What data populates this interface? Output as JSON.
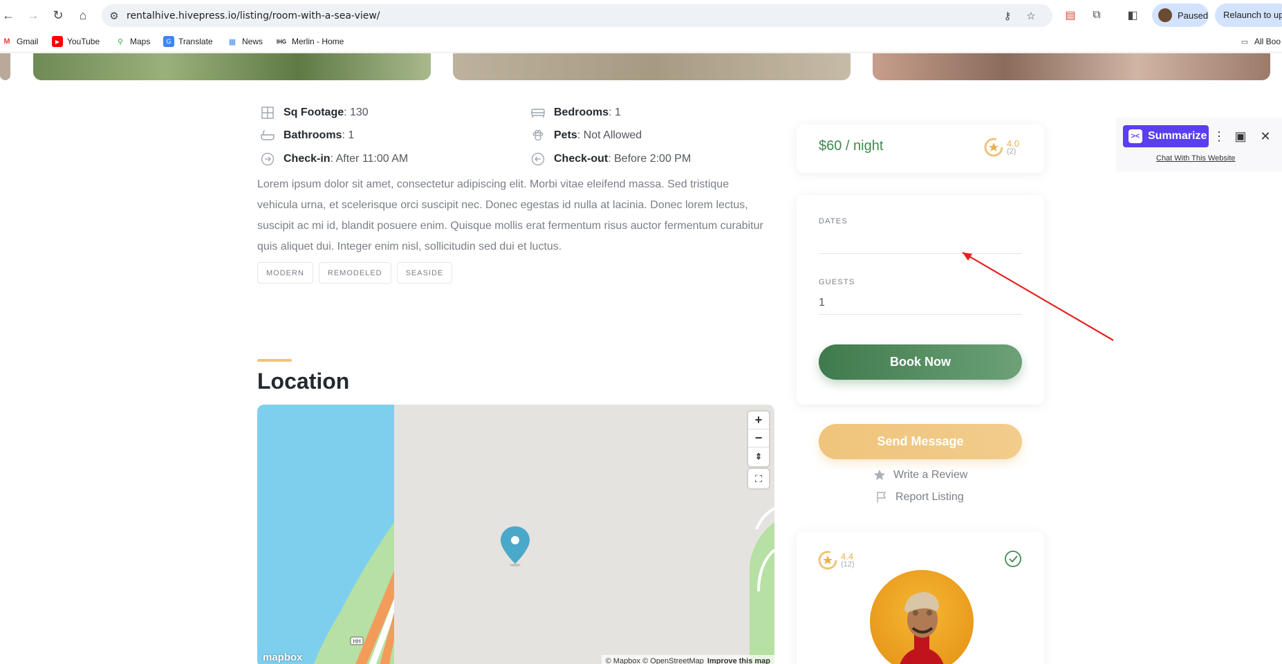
{
  "browser": {
    "url": "rentalhive.hivepress.io/listing/room-with-a-sea-view/",
    "paused_label": "Paused",
    "relaunch_label": "Relaunch to upd"
  },
  "bookmarks": [
    {
      "label": "Gmail",
      "icon": "gmail-icon"
    },
    {
      "label": "YouTube",
      "icon": "youtube-icon"
    },
    {
      "label": "Maps",
      "icon": "maps-icon"
    },
    {
      "label": "Translate",
      "icon": "translate-icon"
    },
    {
      "label": "News",
      "icon": "news-icon"
    },
    {
      "label": "Merlin - Home",
      "icon": "merlin-icon"
    },
    {
      "label": "All Boo",
      "icon": "folder-icon"
    }
  ],
  "listing": {
    "features": [
      {
        "label": "Sq Footage",
        "value": ": 130",
        "icon": "sq-footage-icon"
      },
      {
        "label": "Bedrooms",
        "value": ": 1",
        "icon": "bed-icon"
      },
      {
        "label": "Bathrooms",
        "value": ": 1",
        "icon": "bath-icon"
      },
      {
        "label": "Pets",
        "value": ": Not Allowed",
        "icon": "paw-icon"
      },
      {
        "label": "Check-in",
        "value": ": After 11:00 AM",
        "icon": "arrow-right-circle-icon"
      },
      {
        "label": "Check-out",
        "value": ": Before 2:00 PM",
        "icon": "arrow-left-circle-icon"
      }
    ],
    "description": "Lorem ipsum dolor sit amet, consectetur adipiscing elit. Morbi vitae eleifend massa. Sed tristique vehicula urna, et scelerisque orci suscipit nec. Donec egestas id nulla at lacinia. Donec lorem lectus, suscipit ac mi id, blandit posuere enim. Quisque mollis erat fermentum risus auctor fermentum curabitur quis aliquet dui. Integer enim nisl, sollicitudin sed dui et luctus.",
    "tags": [
      "MODERN",
      "REMODELED",
      "SEASIDE"
    ],
    "location_title": "Location"
  },
  "map": {
    "zoom_in": "+",
    "zoom_out": "−",
    "logo": "mapbox",
    "road_label": "HH",
    "attribution": "© Mapbox © OpenStreetMap",
    "improve": "Improve this map"
  },
  "booking": {
    "price": "$60 / night",
    "rating": "4.0",
    "rating_count": "(2)",
    "dates_label": "DATES",
    "dates_value": "",
    "guests_label": "GUESTS",
    "guests_value": "1",
    "book_button": "Book Now",
    "message_button": "Send Message",
    "review_link": "Write a Review",
    "report_link": "Report Listing"
  },
  "host": {
    "rating": "4.4",
    "rating_count": "(12)"
  },
  "extension": {
    "summarize_label": "Summarize",
    "chat_link": "Chat With This Website"
  },
  "colors": {
    "accent_green": "#3e8a4e",
    "accent_gold": "#f0c37a",
    "annotation_arrow": "#e8201c"
  }
}
